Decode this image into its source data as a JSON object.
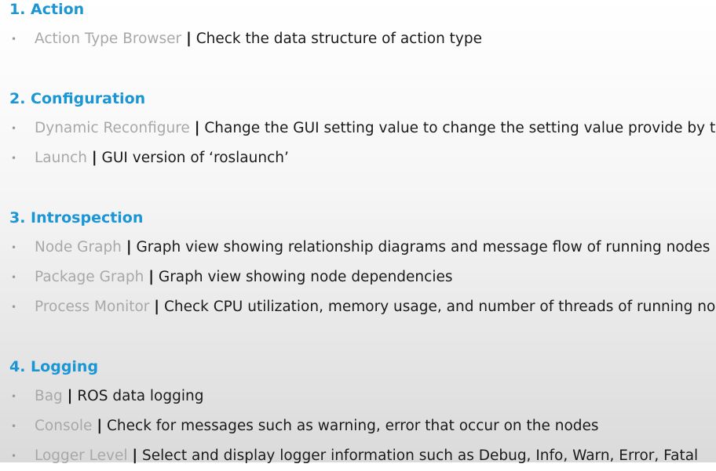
{
  "sections": [
    {
      "title": "1. Action",
      "items": [
        {
          "term": "Action Type Browser",
          "desc": "Check the data structure of action type"
        }
      ]
    },
    {
      "title": "2. Configuration",
      "items": [
        {
          "term": "Dynamic Reconfigure",
          "desc": "Change the GUI setting value to change the setting value provide by th"
        },
        {
          "term": "Launch",
          "desc": "GUI version of ‘roslaunch’"
        }
      ]
    },
    {
      "title": "3. Introspection",
      "items": [
        {
          "term": "Node Graph",
          "desc": "Graph view showing relationship diagrams and message flow of running nodes"
        },
        {
          "term": "Package Graph",
          "desc": "Graph view showing node dependencies"
        },
        {
          "term": "Process Monitor",
          "desc": "Check CPU utilization, memory usage, and number of threads of running no"
        }
      ]
    },
    {
      "title": "4. Logging",
      "items": [
        {
          "term": "Bag",
          "desc": "ROS data logging"
        },
        {
          "term": "Console",
          "desc": "Check for messages such as warning, error that occur on the nodes"
        },
        {
          "term": "Logger Level",
          "desc": "Select and display logger information such as Debug, Info, Warn, Error, Fatal"
        }
      ]
    }
  ],
  "separator": "|",
  "bullet": "•",
  "colors": {
    "heading": "#1a96d4",
    "term": "#a8a8a8",
    "text": "#1a1a1a"
  }
}
